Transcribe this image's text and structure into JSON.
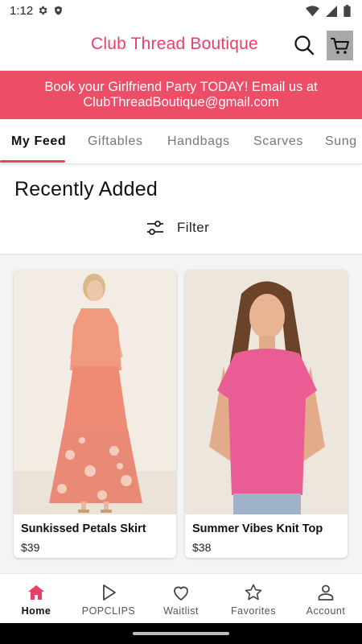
{
  "status_bar": {
    "time": "1:12",
    "left_icons": [
      "gear-icon",
      "shield-icon"
    ],
    "right_icons": [
      "wifi-icon",
      "signal-icon",
      "battery-icon"
    ]
  },
  "header": {
    "title": "Club Thread Boutique",
    "brand_color": "#ec3e67",
    "search_icon": "search-icon",
    "cart_icon": "cart-icon"
  },
  "promo_banner": {
    "line1": "Book your Girlfriend Party TODAY! Email us at",
    "line2": "ClubThreadBoutique@gmail.com",
    "color": "#ee4d68"
  },
  "tabs": [
    {
      "label": "My Feed",
      "active": true
    },
    {
      "label": "Giftables",
      "active": false
    },
    {
      "label": "Handbags",
      "active": false
    },
    {
      "label": "Scarves",
      "active": false
    },
    {
      "label": "Sung",
      "active": false
    }
  ],
  "feed": {
    "section_title": "Recently Added",
    "filter_label": "Filter",
    "filter_icon": "sliders-icon"
  },
  "products": [
    {
      "name": "Sunkissed Petals Skirt",
      "price": "$39"
    },
    {
      "name": "Summer Vibes Knit Top",
      "price": "$38"
    }
  ],
  "bottom_nav": [
    {
      "label": "Home",
      "icon": "home-icon",
      "active": true
    },
    {
      "label": "POPCLIPS",
      "icon": "play-icon",
      "active": false
    },
    {
      "label": "Waitlist",
      "icon": "heart-icon",
      "active": false
    },
    {
      "label": "Favorites",
      "icon": "star-icon",
      "active": false
    },
    {
      "label": "Account",
      "icon": "account-icon",
      "active": false
    }
  ]
}
